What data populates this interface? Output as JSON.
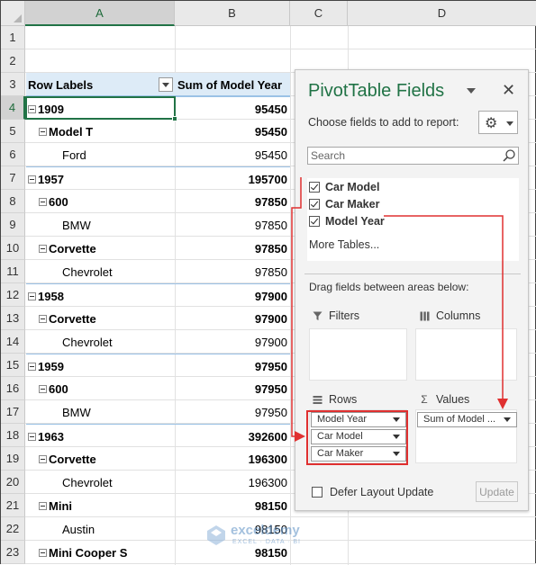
{
  "sheet": {
    "columns": [
      "A",
      "B",
      "C",
      "D"
    ],
    "row_numbers": [
      "1",
      "2",
      "3",
      "4",
      "5",
      "6",
      "7",
      "8",
      "9",
      "10",
      "11",
      "12",
      "13",
      "14",
      "15",
      "16",
      "17",
      "18",
      "19",
      "20",
      "21",
      "22",
      "23"
    ]
  },
  "pivot": {
    "header_label": "Row Labels",
    "header_value": "Sum of Model Year",
    "rows": [
      {
        "label": "1909",
        "value": "95450",
        "level": 1,
        "toggle": true
      },
      {
        "label": "Model T",
        "value": "95450",
        "level": 2,
        "toggle": true
      },
      {
        "label": "Ford",
        "value": "95450",
        "level": 3,
        "toggle": false
      },
      {
        "label": "1957",
        "value": "195700",
        "level": 1,
        "toggle": true
      },
      {
        "label": "600",
        "value": "97850",
        "level": 2,
        "toggle": true
      },
      {
        "label": "BMW",
        "value": "97850",
        "level": 3,
        "toggle": false
      },
      {
        "label": "Corvette",
        "value": "97850",
        "level": 2,
        "toggle": true
      },
      {
        "label": "Chevrolet",
        "value": "97850",
        "level": 3,
        "toggle": false
      },
      {
        "label": "1958",
        "value": "97900",
        "level": 1,
        "toggle": true
      },
      {
        "label": "Corvette",
        "value": "97900",
        "level": 2,
        "toggle": true
      },
      {
        "label": "Chevrolet",
        "value": "97900",
        "level": 3,
        "toggle": false
      },
      {
        "label": "1959",
        "value": "97950",
        "level": 1,
        "toggle": true
      },
      {
        "label": "600",
        "value": "97950",
        "level": 2,
        "toggle": true
      },
      {
        "label": "BMW",
        "value": "97950",
        "level": 3,
        "toggle": false
      },
      {
        "label": "1963",
        "value": "392600",
        "level": 1,
        "toggle": true
      },
      {
        "label": "Corvette",
        "value": "196300",
        "level": 2,
        "toggle": true
      },
      {
        "label": "Chevrolet",
        "value": "196300",
        "level": 3,
        "toggle": false
      },
      {
        "label": "Mini",
        "value": "98150",
        "level": 2,
        "toggle": true
      },
      {
        "label": "Austin",
        "value": "98150",
        "level": 3,
        "toggle": false
      },
      {
        "label": "Mini Cooper S",
        "value": "98150",
        "level": 2,
        "toggle": true
      }
    ]
  },
  "pane": {
    "title": "PivotTable Fields",
    "close_glyph": "✕",
    "choose_label": "Choose fields to add to report:",
    "gear_glyph": "⚙",
    "search_placeholder": "Search",
    "fields": [
      {
        "label": "Car Model",
        "checked": true
      },
      {
        "label": "Car Maker",
        "checked": true
      },
      {
        "label": "Model Year",
        "checked": true
      }
    ],
    "more_tables": "More Tables...",
    "drag_label": "Drag fields between areas below:",
    "areas": {
      "filters": {
        "label": "Filters",
        "icon": "filter-icon"
      },
      "columns": {
        "label": "Columns",
        "icon": "columns-icon"
      },
      "rows": {
        "label": "Rows",
        "icon": "rows-icon",
        "chips": [
          "Model Year",
          "Car Model",
          "Car Maker"
        ]
      },
      "values": {
        "label": "Values",
        "icon": "sigma-icon",
        "chips": [
          "Sum of Model ..."
        ]
      }
    },
    "defer_label": "Defer Layout Update",
    "update_label": "Update"
  },
  "watermark": {
    "name": "exceldemy",
    "tagline": "EXCEL · DATA · BI"
  },
  "colors": {
    "accent": "#217346",
    "highlight": "#e03030",
    "header_fill": "#ddebf7"
  }
}
